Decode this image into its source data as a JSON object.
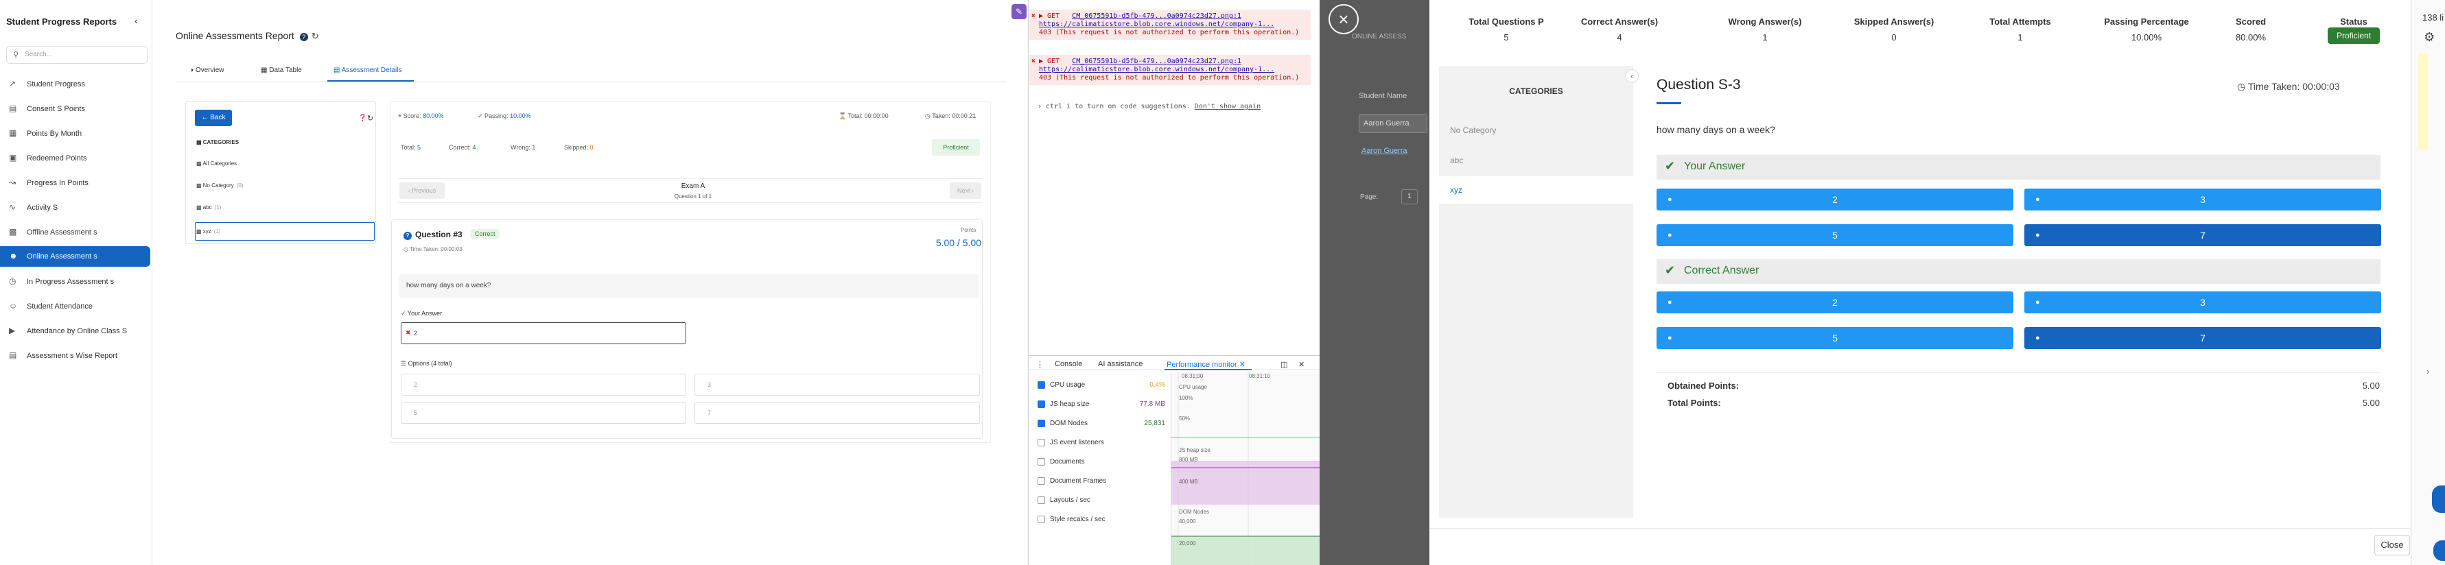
{
  "sidebar": {
    "title": "Student Progress Reports",
    "search_placeholder": "Search...",
    "items": [
      {
        "label": "Student Progress",
        "icon": "chart-icon"
      },
      {
        "label": "Consent S Points",
        "icon": "document-icon"
      },
      {
        "label": "Points By Month",
        "icon": "calendar-icon"
      },
      {
        "label": "Redeemed Points",
        "icon": "gift-icon"
      },
      {
        "label": "Progress In Points",
        "icon": "trend-icon"
      },
      {
        "label": "Activity S",
        "icon": "activity-icon"
      },
      {
        "label": "Offline Assessment s",
        "icon": "folder-icon"
      },
      {
        "label": "Online Assessment s",
        "icon": "users-icon",
        "active": true
      },
      {
        "label": "In Progress Assessment s",
        "icon": "clock-icon"
      },
      {
        "label": "Student Attendance",
        "icon": "user-icon"
      },
      {
        "label": "Attendance by Online Class S",
        "icon": "video-icon"
      },
      {
        "label": "Assessment s Wise Report",
        "icon": "report-icon"
      }
    ]
  },
  "main": {
    "title": "Online Assessments Report",
    "tabs": [
      {
        "label": "Overview"
      },
      {
        "label": "Data Table"
      },
      {
        "label": "Assessment Details"
      }
    ],
    "back_label": "Back",
    "categories_label": "CATEGORIES",
    "categories": [
      {
        "label": "All Categories",
        "count": ""
      },
      {
        "label": "No Category",
        "count": "(0)"
      },
      {
        "label": "abc",
        "count": "(1)"
      },
      {
        "label": "xyz",
        "count": "(1)"
      }
    ],
    "stats": {
      "score_label": "Score:",
      "score": "80.00%",
      "passing_label": "Passing:",
      "passing": "10.00%",
      "total_time_label": "Total:",
      "total_time": "00:00:00",
      "taken_label": "Taken:",
      "taken": "00:00:21"
    },
    "summary": {
      "total_label": "Total:",
      "total": "5",
      "correct_label": "Correct:",
      "correct": "4",
      "wrong_label": "Wrong:",
      "wrong": "1",
      "skipped_label": "Skipped:",
      "skipped": "0",
      "badge": "Proficient"
    },
    "nav": {
      "previous": "Previous",
      "next": "Next",
      "exam_name": "Exam A",
      "question_count": "Question 1 of 1"
    },
    "question": {
      "title": "Question #3",
      "badge": "Correct",
      "points_label": "Points",
      "points": "5.00 / 5.00",
      "time_taken": "Time Taken: 00:00:03",
      "text": "how many days on a week?",
      "your_answer_label": "Your Answer",
      "your_answer": "2",
      "options_label": "Options (4 total)",
      "options": [
        "2",
        "3",
        "5",
        "7"
      ]
    }
  },
  "console": {
    "errors": [
      {
        "method": "▶ GET",
        "url": "https://calimaticstore.blob.core.windows.net/company-1...",
        "file": "CM_0675591b-d5fb-479...0a0974c23d27.png:1",
        "msg": "403 (This request is not authorized to perform this operation.)"
      },
      {
        "method": "▶ GET",
        "url": "https://calimaticstore.blob.core.windows.net/company-1...",
        "file": "CM_0675591b-d5fb-479...0a0974c23d27.png:1",
        "msg": "403 (This request is not authorized to perform this operation.)"
      }
    ],
    "hint": "ctrl  i  to turn on code suggestions.",
    "hint_dismiss": "Don't show again",
    "tabs": [
      {
        "label": "Console"
      },
      {
        "label": "AI assistance"
      },
      {
        "label": "Performance monitor"
      }
    ],
    "metrics": [
      {
        "label": "CPU usage",
        "value": "0.4%",
        "on": true,
        "color": "#e8a317"
      },
      {
        "label": "JS heap size",
        "value": "77.8 MB",
        "on": true,
        "color": "#9c27b0"
      },
      {
        "label": "DOM Nodes",
        "value": "25,831",
        "on": true,
        "color": "#2e7d32"
      },
      {
        "label": "JS event listeners",
        "value": "",
        "on": false
      },
      {
        "label": "Documents",
        "value": "",
        "on": false
      },
      {
        "label": "Document Frames",
        "value": "",
        "on": false
      },
      {
        "label": "Layouts / sec",
        "value": "",
        "on": false
      },
      {
        "label": "Style recalcs / sec",
        "value": "",
        "on": false
      }
    ],
    "graph": {
      "time1": "08:31:00",
      "time2": "08:31:10",
      "cpu_label": "CPU usage",
      "cpu_100": "100%",
      "cpu_50": "50%",
      "heap_label": "JS heap size",
      "heap_800": "800 MB",
      "heap_400": "400 MB",
      "dom_label": "DOM Nodes",
      "dom_40000": "40,000",
      "dom_20000": "20,000"
    }
  },
  "bg_page": {
    "section": "ONLINE ASSESS",
    "student_name_label": "Student Name",
    "student_name": "Aaron Guerra",
    "student_link": "Aaron Guerra",
    "page_label": "Page:",
    "page_value": "1"
  },
  "drawer": {
    "stats": [
      {
        "label": "Total Questions P",
        "value": "5"
      },
      {
        "label": "Correct Answer(s)",
        "value": "4"
      },
      {
        "label": "Wrong Answer(s)",
        "value": "1"
      },
      {
        "label": "Skipped Answer(s)",
        "value": "0"
      },
      {
        "label": "Total Attempts",
        "value": "1"
      },
      {
        "label": "Passing Percentage",
        "value": "10.00%"
      },
      {
        "label": "Scored",
        "value": "80.00%"
      },
      {
        "label": "Status",
        "value": "Proficient"
      }
    ],
    "categories_label": "CATEGORIES",
    "categories": [
      "No Category",
      "abc",
      "xyz"
    ],
    "question_title": "Question S-3",
    "time_taken": "Time Taken: 00:00:03",
    "question_text": "how many days on a week?",
    "your_answer_label": "Your Answer",
    "correct_answer_label": "Correct Answer",
    "answers": [
      "2",
      "3",
      "5",
      "7"
    ],
    "obtained_label": "Obtained Points:",
    "obtained": "5.00",
    "total_label": "Total Points:",
    "total": "5.00",
    "close_label": "Close"
  },
  "edge": {
    "text": "138 li"
  },
  "colors": {
    "primary": "#1565c0",
    "answer_button": "#2196f3",
    "success": "#2e7d32",
    "console_error_bg": "#fce8e6"
  }
}
